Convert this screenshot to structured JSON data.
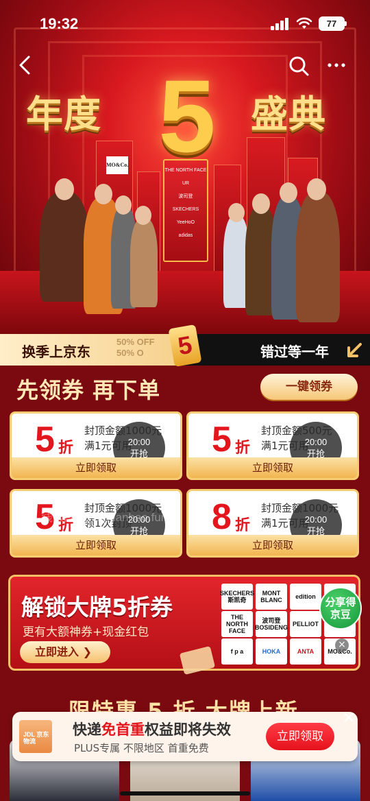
{
  "status_bar": {
    "time": "19:32",
    "battery": "77"
  },
  "hero": {
    "title_left": "年度",
    "title_number": "5",
    "title_right": "盛典",
    "tower_brands": [
      "THE NORTH FACE",
      "UR",
      "波司登",
      "SKECHERS",
      "YeeHoO",
      "adidas"
    ],
    "building_sign": "MO&Co."
  },
  "strip": {
    "left_text": "换季上京东",
    "off_text_1": "50% OFF",
    "off_text_2": "50% O",
    "tag_number": "5",
    "right_text": "错过等一年"
  },
  "coupons_section": {
    "heading": "先领券 再下单",
    "one_click": "一键领券",
    "coupons": [
      {
        "discount": "5",
        "unit": "折",
        "line1": "封顶金额1000元",
        "line2": "满1元可用",
        "timer_time": "20:00",
        "timer_label": "开抢",
        "claim": "立即领取"
      },
      {
        "discount": "5",
        "unit": "折",
        "line1": "封顶金额500元",
        "line2": "满1元可用",
        "timer_time": "20:00",
        "timer_label": "开抢",
        "claim": "立即领取"
      },
      {
        "discount": "5",
        "unit": "折",
        "line1": "封顶金额1000元",
        "line2": "领1次封顶",
        "timer_time": "20:00",
        "timer_label": "开抢",
        "claim": "立即领取"
      },
      {
        "discount": "8",
        "unit": "折",
        "line1": "封顶金额1000元",
        "line2": "满1元可用",
        "timer_time": "20:00",
        "timer_label": "开抢",
        "claim": "立即领取"
      }
    ],
    "watermark": "线报酷 www.xianbao.fun"
  },
  "brand_banner": {
    "title": "解锁大牌5折券",
    "subtitle": "更有大额神券+现金红包",
    "enter": "立即进入",
    "logos": [
      "SKECHERS 斯凯奇",
      "MONT BLANC",
      "edition",
      "T",
      "THE NORTH FACE",
      "波司登 BOSIDENG",
      "PELLIOT",
      "",
      "f p a",
      "HOKA",
      "ANTA",
      "MO&Co."
    ],
    "share": "分享得京豆"
  },
  "next_section": {
    "heading": "限特惠 5 折 大牌上新"
  },
  "notice": {
    "box_label": "JDL 京东物流",
    "title_prefix": "快递",
    "title_highlight": "免首重",
    "title_suffix": "权益即将失效",
    "subtitle": "PLUS专属  不限地区  首重免费",
    "button": "立即领取"
  },
  "colors": {
    "accent_red": "#e3161d",
    "gold": "#f4c067",
    "dark_red": "#7a0a10"
  }
}
